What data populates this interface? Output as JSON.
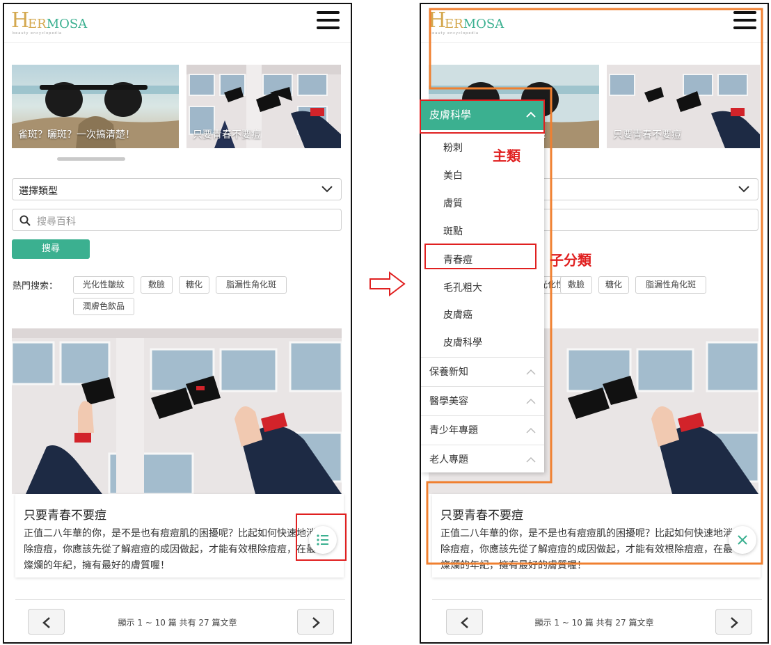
{
  "logo": {
    "initial": "H",
    "er": "ER",
    "rest": "MOSA",
    "tagline": "beauty encyclopedia"
  },
  "carousel": [
    {
      "caption": "雀斑？曬斑？一次搞清楚！"
    },
    {
      "caption": "只要青春不要痘"
    }
  ],
  "filter": {
    "select_label": "選擇類型",
    "search_placeholder": "搜尋百科",
    "search_button": "搜尋"
  },
  "hot": {
    "label": "熱門搜索：",
    "tags": [
      "光化性皺紋",
      "敷臉",
      "糖化",
      "脂漏性角化斑",
      "潤膚色飲品"
    ]
  },
  "article": {
    "title": "只要青春不要痘",
    "body": "正值二八年華的你，是不是也有痘痘肌的困擾呢？比起如何快速地消除痘痘，你應該先從了解痘痘的成因做起，才能有效根除痘痘，在最燦爛的年紀，擁有最好的膚質喔！"
  },
  "pagination": {
    "info": "顯示 1 ~ 10 篇 共有 27 篇文章"
  },
  "menu": {
    "main": "皮膚科學",
    "subs": [
      "粉刺",
      "美白",
      "膚質",
      "斑點",
      "青春痘",
      "毛孔粗大",
      "皮膚癌",
      "皮膚科學"
    ],
    "groups": [
      "保養新知",
      "醫學美容",
      "青少年專題",
      "老人專題"
    ]
  },
  "annotations": {
    "main_label": "主類",
    "sub_label": "子分類"
  },
  "colors": {
    "accent": "#3bb090",
    "annotation_red": "#e02020",
    "annotation_orange": "#f08030",
    "logo_gold": "#d4a84f"
  }
}
